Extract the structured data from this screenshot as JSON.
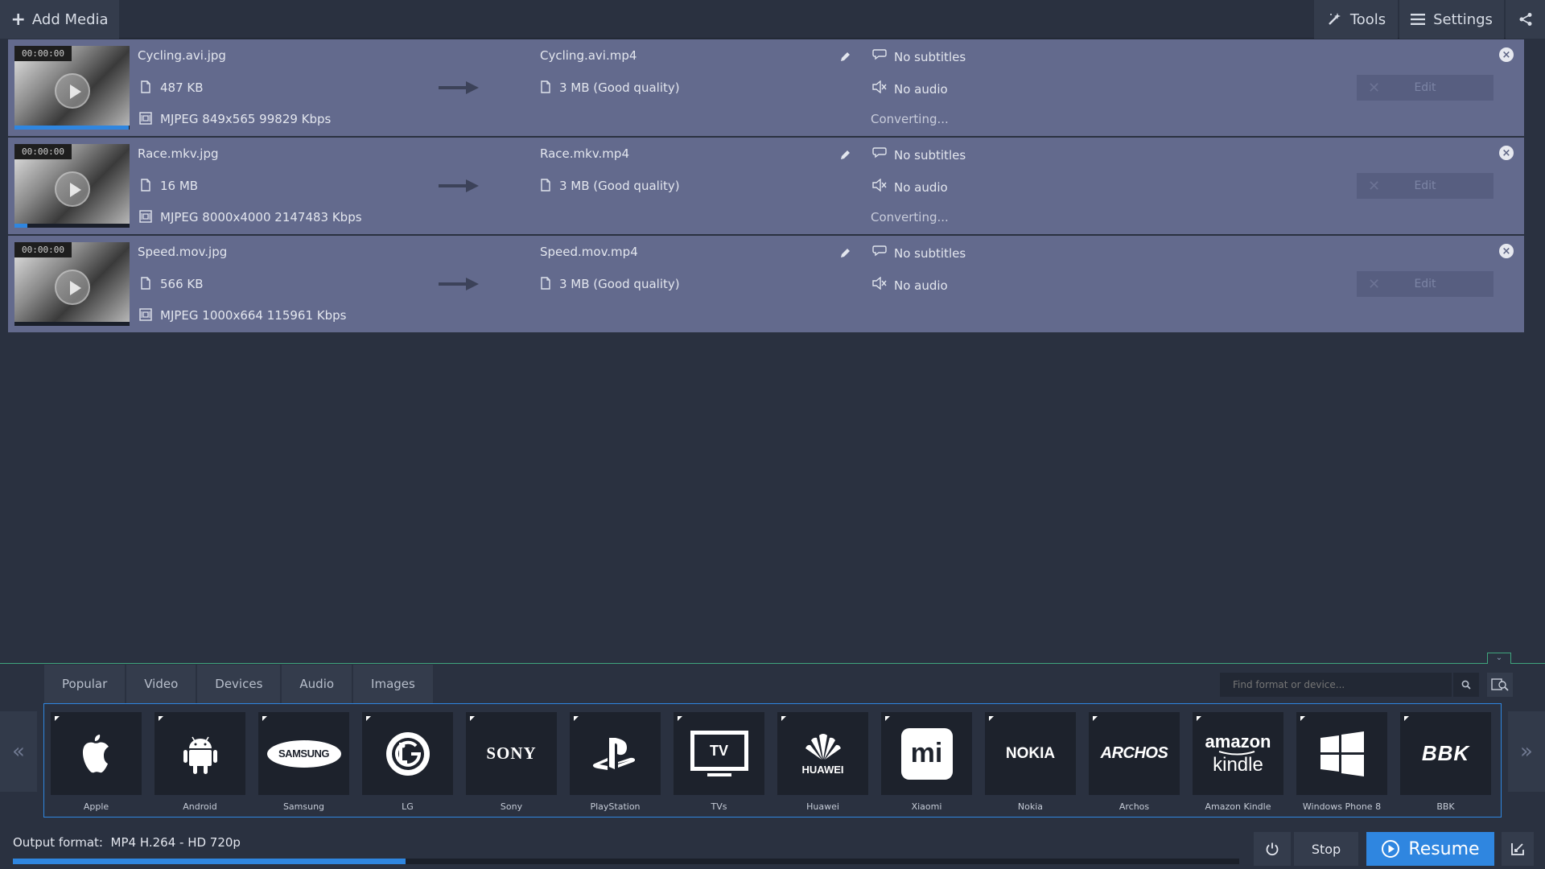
{
  "toolbar": {
    "add_media_label": "Add Media",
    "tools_label": "Tools",
    "settings_label": "Settings"
  },
  "files": [
    {
      "timecode": "00:00:00",
      "name": "Cycling.avi.jpg",
      "size": "487 KB",
      "info": "MJPEG 849x565 99829 Kbps",
      "output_name": "Cycling.avi.mp4",
      "output_size": "3 MB (Good quality)",
      "subtitles": "No subtitles",
      "audio": "No audio",
      "status": "Converting...",
      "edit_label": "Edit",
      "progress": 0.99
    },
    {
      "timecode": "00:00:00",
      "name": "Race.mkv.jpg",
      "size": "16 MB",
      "info": "MJPEG 8000x4000 2147483 Kbps",
      "output_name": "Race.mkv.mp4",
      "output_size": "3 MB (Good quality)",
      "subtitles": "No subtitles",
      "audio": "No audio",
      "status": "Converting...",
      "edit_label": "Edit",
      "progress": 0.11
    },
    {
      "timecode": "00:00:00",
      "name": "Speed.mov.jpg",
      "size": "566 KB",
      "info": "MJPEG 1000x664 115961 Kbps",
      "output_name": "Speed.mov.mp4",
      "output_size": "3 MB (Good quality)",
      "subtitles": "No subtitles",
      "audio": "No audio",
      "status": "",
      "edit_label": "Edit",
      "progress": 0
    }
  ],
  "format_tabs": [
    "Popular",
    "Video",
    "Devices",
    "Audio",
    "Images"
  ],
  "search": {
    "placeholder": "Find format or device..."
  },
  "devices": [
    {
      "label": "Apple",
      "icon": "apple-icon"
    },
    {
      "label": "Android",
      "icon": "android-icon"
    },
    {
      "label": "Samsung",
      "logo": "SAMSUNG"
    },
    {
      "label": "LG",
      "icon": "lg-icon"
    },
    {
      "label": "Sony",
      "logo": "SONY"
    },
    {
      "label": "PlayStation",
      "icon": "playstation-icon"
    },
    {
      "label": "TVs",
      "logo": "TV"
    },
    {
      "label": "Huawei",
      "logo": "HUAWEI"
    },
    {
      "label": "Xiaomi",
      "logo": "mi"
    },
    {
      "label": "Nokia",
      "logo": "NOKIA"
    },
    {
      "label": "Archos",
      "logo": "ARCHOS"
    },
    {
      "label": "Amazon Kindle",
      "logo": "amazon",
      "logo2": "kindle"
    },
    {
      "label": "Windows Phone 8",
      "icon": "windows-icon"
    },
    {
      "label": "BBK",
      "logo": "BBK"
    }
  ],
  "bottom": {
    "output_format_label": "Output format:",
    "output_format_value": "MP4 H.264 - HD 720p",
    "stop_label": "Stop",
    "resume_label": "Resume",
    "total_progress": 0.32
  },
  "colors": {
    "accent": "#2f86e0",
    "row_bg": "#636a8d",
    "app_bg": "#2a3140",
    "panel_divider": "#3fa57d"
  }
}
